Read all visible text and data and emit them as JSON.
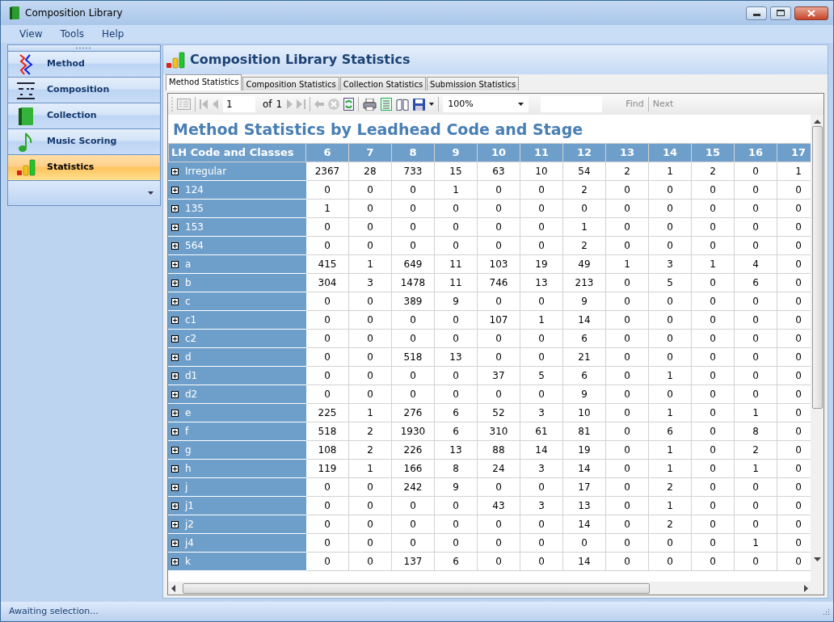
{
  "window": {
    "title": "Composition Library"
  },
  "menu": [
    "View",
    "Tools",
    "Help"
  ],
  "sidebar": {
    "items": [
      {
        "label": "Method",
        "kind": "method",
        "selected": false
      },
      {
        "label": "Composition",
        "kind": "composition",
        "selected": false
      },
      {
        "label": "Collection",
        "kind": "collection",
        "selected": false
      },
      {
        "label": "Music Scoring",
        "kind": "music",
        "selected": false
      },
      {
        "label": "Statistics",
        "kind": "statistics",
        "selected": true
      }
    ]
  },
  "header": {
    "title": "Composition Library Statistics"
  },
  "tabs": [
    {
      "label": "Method Statistics",
      "selected": true
    },
    {
      "label": "Composition Statistics",
      "selected": false
    },
    {
      "label": "Collection Statistics",
      "selected": false
    },
    {
      "label": "Submission Statistics",
      "selected": false
    }
  ],
  "toolbar": {
    "page": "1",
    "of_label": "of",
    "page_total": "1",
    "zoom": "100%",
    "find": "Find",
    "next": "Next"
  },
  "report": {
    "title": "Method Statistics by Leadhead Code and Stage",
    "columns": [
      "LH Code and Classes",
      "6",
      "7",
      "8",
      "9",
      "10",
      "11",
      "12",
      "13",
      "14",
      "15",
      "16",
      "17"
    ],
    "rows": [
      {
        "label": "Irregular",
        "values": [
          "2367",
          "28",
          "733",
          "15",
          "63",
          "10",
          "54",
          "2",
          "1",
          "2",
          "0",
          "1"
        ]
      },
      {
        "label": "124",
        "values": [
          "0",
          "0",
          "0",
          "1",
          "0",
          "0",
          "2",
          "0",
          "0",
          "0",
          "0",
          "0"
        ]
      },
      {
        "label": "135",
        "values": [
          "1",
          "0",
          "0",
          "0",
          "0",
          "0",
          "0",
          "0",
          "0",
          "0",
          "0",
          "0"
        ]
      },
      {
        "label": "153",
        "values": [
          "0",
          "0",
          "0",
          "0",
          "0",
          "0",
          "1",
          "0",
          "0",
          "0",
          "0",
          "0"
        ]
      },
      {
        "label": "564",
        "values": [
          "0",
          "0",
          "0",
          "0",
          "0",
          "0",
          "2",
          "0",
          "0",
          "0",
          "0",
          "0"
        ]
      },
      {
        "label": "a",
        "values": [
          "415",
          "1",
          "649",
          "11",
          "103",
          "19",
          "49",
          "1",
          "3",
          "1",
          "4",
          "0"
        ]
      },
      {
        "label": "b",
        "values": [
          "304",
          "3",
          "1478",
          "11",
          "746",
          "13",
          "213",
          "0",
          "5",
          "0",
          "6",
          "0"
        ]
      },
      {
        "label": "c",
        "values": [
          "0",
          "0",
          "389",
          "9",
          "0",
          "0",
          "9",
          "0",
          "0",
          "0",
          "0",
          "0"
        ]
      },
      {
        "label": "c1",
        "values": [
          "0",
          "0",
          "0",
          "0",
          "107",
          "1",
          "14",
          "0",
          "0",
          "0",
          "0",
          "0"
        ]
      },
      {
        "label": "c2",
        "values": [
          "0",
          "0",
          "0",
          "0",
          "0",
          "0",
          "6",
          "0",
          "0",
          "0",
          "0",
          "0"
        ]
      },
      {
        "label": "d",
        "values": [
          "0",
          "0",
          "518",
          "13",
          "0",
          "0",
          "21",
          "0",
          "0",
          "0",
          "0",
          "0"
        ]
      },
      {
        "label": "d1",
        "values": [
          "0",
          "0",
          "0",
          "0",
          "37",
          "5",
          "6",
          "0",
          "1",
          "0",
          "0",
          "0"
        ]
      },
      {
        "label": "d2",
        "values": [
          "0",
          "0",
          "0",
          "0",
          "0",
          "0",
          "9",
          "0",
          "0",
          "0",
          "0",
          "0"
        ]
      },
      {
        "label": "e",
        "values": [
          "225",
          "1",
          "276",
          "6",
          "52",
          "3",
          "10",
          "0",
          "1",
          "0",
          "1",
          "0"
        ]
      },
      {
        "label": "f",
        "values": [
          "518",
          "2",
          "1930",
          "6",
          "310",
          "61",
          "81",
          "0",
          "6",
          "0",
          "8",
          "0"
        ]
      },
      {
        "label": "g",
        "values": [
          "108",
          "2",
          "226",
          "13",
          "88",
          "14",
          "19",
          "0",
          "1",
          "0",
          "2",
          "0"
        ]
      },
      {
        "label": "h",
        "values": [
          "119",
          "1",
          "166",
          "8",
          "24",
          "3",
          "14",
          "0",
          "1",
          "0",
          "1",
          "0"
        ]
      },
      {
        "label": "j",
        "values": [
          "0",
          "0",
          "242",
          "9",
          "0",
          "0",
          "17",
          "0",
          "2",
          "0",
          "0",
          "0"
        ]
      },
      {
        "label": "j1",
        "values": [
          "0",
          "0",
          "0",
          "0",
          "43",
          "3",
          "13",
          "0",
          "1",
          "0",
          "0",
          "0"
        ]
      },
      {
        "label": "j2",
        "values": [
          "0",
          "0",
          "0",
          "0",
          "0",
          "0",
          "14",
          "0",
          "2",
          "0",
          "0",
          "0"
        ]
      },
      {
        "label": "j4",
        "values": [
          "0",
          "0",
          "0",
          "0",
          "0",
          "0",
          "0",
          "0",
          "0",
          "0",
          "1",
          "0"
        ]
      },
      {
        "label": "k",
        "values": [
          "0",
          "0",
          "137",
          "6",
          "0",
          "0",
          "14",
          "0",
          "0",
          "0",
          "0",
          "0"
        ]
      }
    ]
  },
  "status_bar": "Awaiting selection..."
}
